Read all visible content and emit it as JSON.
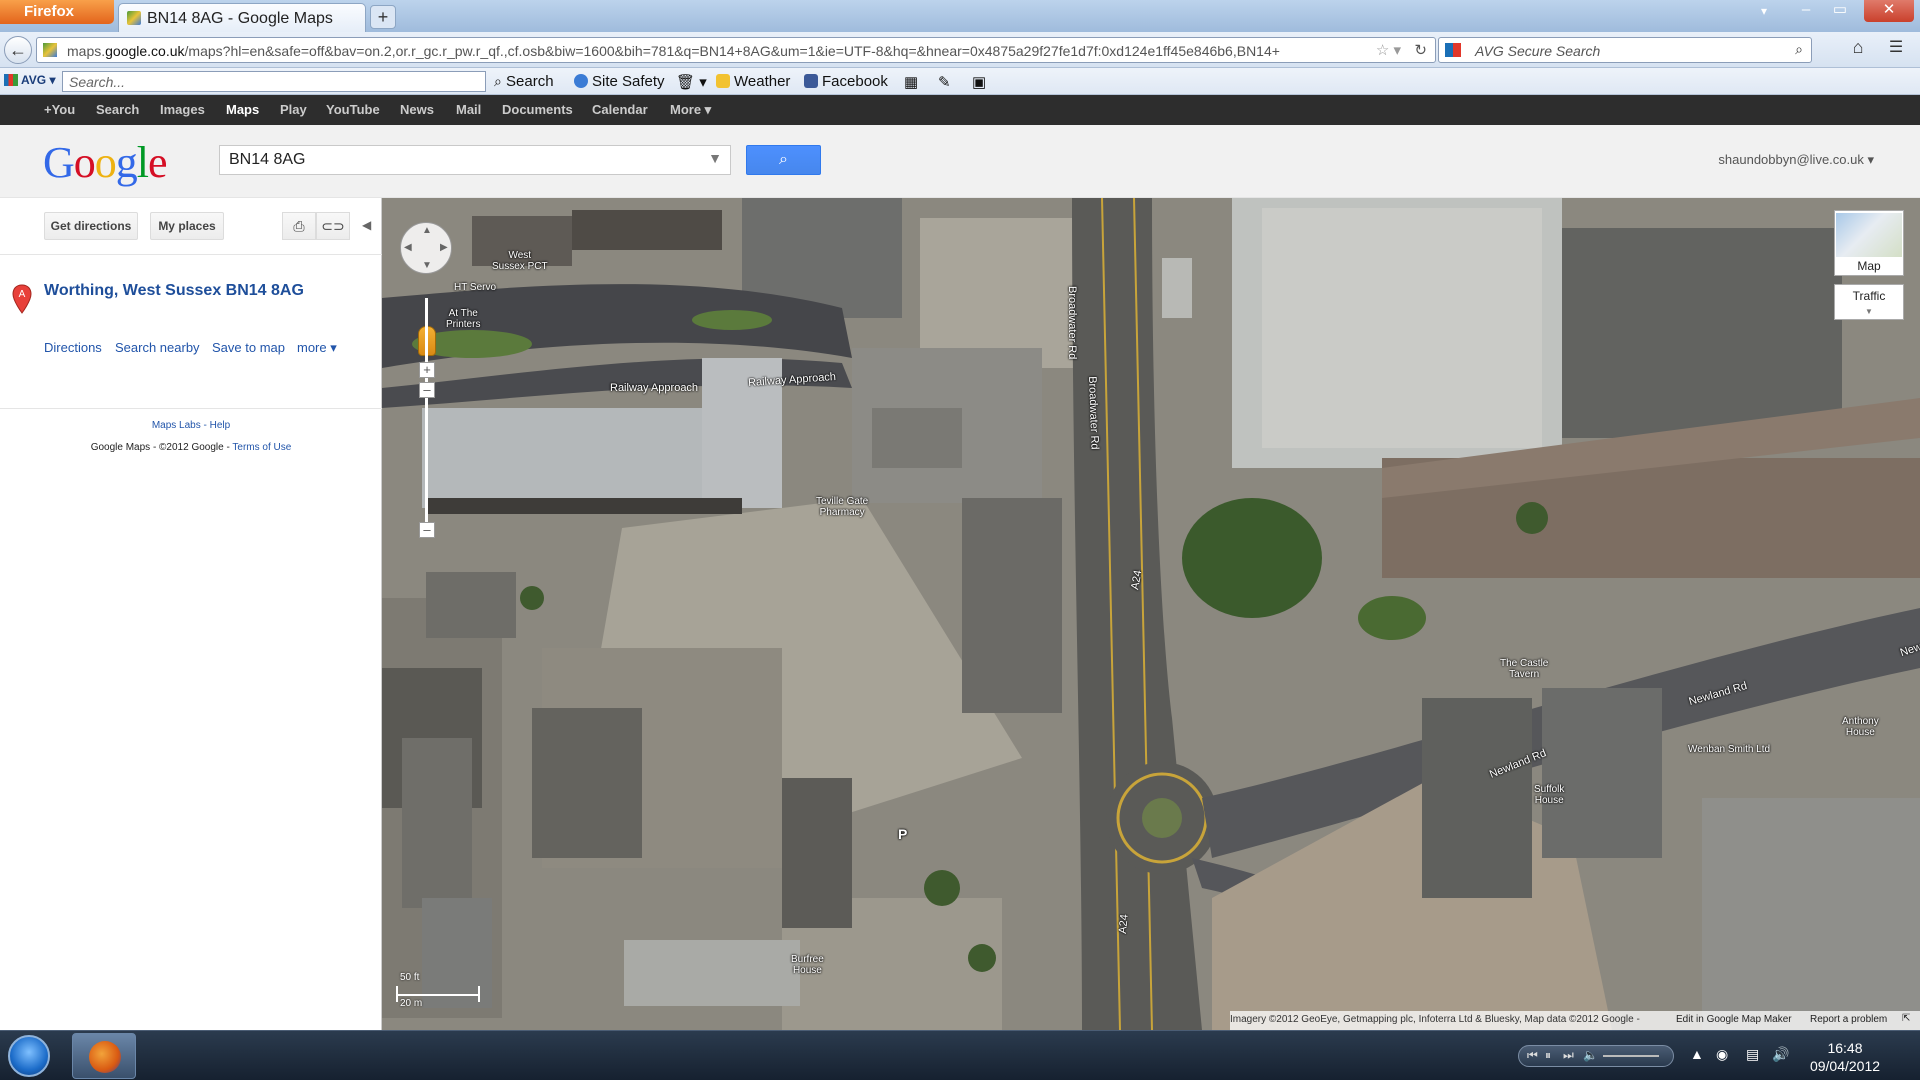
{
  "browser": {
    "app_button": "Firefox",
    "tab_title": "BN14 8AG - Google Maps",
    "new_tab": "+",
    "url_plain": "maps.",
    "url_domain": "google.co.uk",
    "url_rest": "/maps?hl=en&safe=off&bav=on.2,or.r_gc.r_pw.r_qf.,cf.osb&biw=1600&bih=781&q=BN14+8AG&um=1&ie=UTF-8&hq=&hnear=0x4875a29f27fe1d7f:0xd124e1ff45e846b6,BN14+",
    "search_placeholder": "AVG Secure Search"
  },
  "avg_toolbar": {
    "logo": "AVG",
    "search_placeholder": "Search...",
    "search_btn": "Search",
    "site_safety": "Site Safety",
    "weather": "Weather",
    "facebook": "Facebook"
  },
  "google_bar": {
    "items": [
      "+You",
      "Search",
      "Images",
      "Maps",
      "Play",
      "YouTube",
      "News",
      "Mail",
      "Documents",
      "Calendar",
      "More ▾"
    ],
    "active": "Maps"
  },
  "header": {
    "logo": "Google",
    "query": "BN14 8AG",
    "account": "shaundobbyn@live.co.uk ▾"
  },
  "panel": {
    "get_directions": "Get directions",
    "my_places": "My places",
    "marker_letter": "A",
    "result_name": "Worthing, West Sussex BN14 8AG",
    "links": [
      "Directions",
      "Search nearby",
      "Save to map",
      "more ▾"
    ],
    "maps_labs": "Maps Labs - Help",
    "copyright": "Google Maps - ©2012 Google - ",
    "terms": "Terms of Use"
  },
  "map": {
    "labels": {
      "west_sussex_pct": "West\nSussex PCT",
      "ht_servo": "HT Servo",
      "at_the_printers": "At The\nPrinters",
      "railway_approach_1": "Railway Approach",
      "railway_approach_2": "Railway Approach",
      "teville_gate": "Teville Gate\nPharmacy",
      "broadwater_rd_1": "Broadwater Rd",
      "broadwater_rd_2": "Broadwater Rd",
      "a24_top": "A24",
      "a24_bottom": "A24",
      "castle_tavern": "The Castle\nTavern",
      "newland_rd_1": "Newland Rd",
      "newland_rd_2": "Newland Rd",
      "newland_rd_3": "New",
      "wenban_smith": "Wenban Smith Ltd",
      "anthony_house": "Anthony\nHouse",
      "suffolk_house": "Suffolk\nHouse",
      "burfree_house": "Burfree\nHouse",
      "parking": "P"
    },
    "map_type": "Map",
    "traffic": "Traffic",
    "scale_ft": "50 ft",
    "scale_m": "20 m",
    "attribution": "Imagery ©2012 GeoEye, Getmapping plc, Infoterra Ltd & Bluesky, Map data ©2012 Google -",
    "edit_link": "Edit in Google Map Maker",
    "report": "Report a problem"
  },
  "taskbar": {
    "time": "16:48",
    "date": "09/04/2012"
  }
}
